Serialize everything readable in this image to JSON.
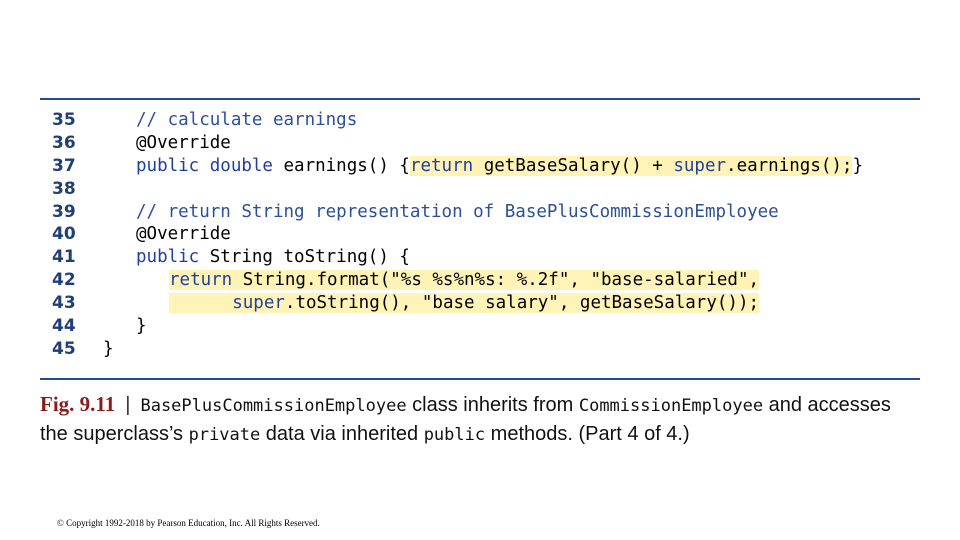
{
  "code": {
    "line_numbers": [
      "35",
      "36",
      "37",
      "38",
      "39",
      "40",
      "41",
      "42",
      "43",
      "44",
      "45"
    ],
    "l35": "// calculate earnings",
    "l36": "@Override",
    "l37_a_kw": "public double",
    "l37_b": " earnings() {",
    "l37_c_kw": "return",
    "l37_d": " getBaseSalary() + ",
    "l37_e_kw": "super",
    "l37_f": ".earnings();",
    "l37_g": "}",
    "l39": "// return String representation of BasePlusCommissionEmployee",
    "l40": "@Override",
    "l41_a_kw": "public",
    "l41_b": " String toString() {",
    "l42_indent": "   ",
    "l42_a_kw": "return",
    "l42_b": " String.format(\"%s %s%n%s: %.2f\", \"base-salaried\",",
    "l43_indent": "      ",
    "l43_a_kw": "super",
    "l43_b": ".toString(), \"base salary\", getBaseSalary());",
    "l44": "}",
    "l45": "}"
  },
  "caption": {
    "fig_label": "Fig. 9.11",
    "separator": "|",
    "class_name": "BasePlusCommissionEmployee",
    "text_1": " class inherits from ",
    "super_class": "CommissionEmployee",
    "text_2": " and accesses the superclass’s ",
    "private_kw": "private",
    "text_3": " data via inherited ",
    "public_kw": "public",
    "text_4": " methods. (Part 4 of 4.)"
  },
  "copyright": "© Copyright 1992-2018 by Pearson Education, Inc. All Rights Reserved."
}
